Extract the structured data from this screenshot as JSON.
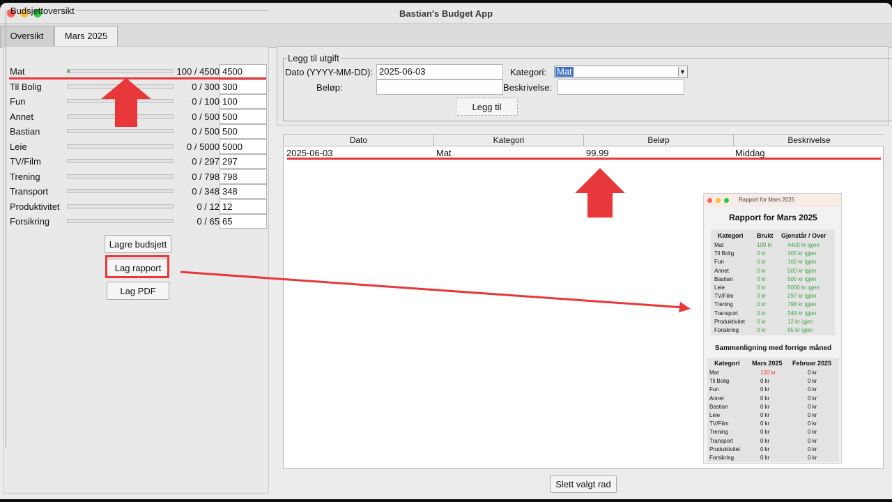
{
  "window": {
    "title": "Bastian's Budget App"
  },
  "tabs": [
    {
      "label": "Oversikt"
    },
    {
      "label": "Mars 2025"
    }
  ],
  "budget": {
    "group_label": "Budsjettoversikt",
    "rows": [
      {
        "name": "Mat",
        "status": "100 / 4500",
        "input": "4500",
        "fill": 0.022
      },
      {
        "name": "Til Bolig",
        "status": "0 / 300",
        "input": "300",
        "fill": 0
      },
      {
        "name": "Fun",
        "status": "0 / 100",
        "input": "100",
        "fill": 0
      },
      {
        "name": "Annet",
        "status": "0 / 500",
        "input": "500",
        "fill": 0
      },
      {
        "name": "Bastian",
        "status": "0 / 500",
        "input": "500",
        "fill": 0
      },
      {
        "name": "Leie",
        "status": "0 / 5000",
        "input": "5000",
        "fill": 0
      },
      {
        "name": "TV/Film",
        "status": "0 / 297",
        "input": "297",
        "fill": 0
      },
      {
        "name": "Trening",
        "status": "0 / 798",
        "input": "798",
        "fill": 0
      },
      {
        "name": "Transport",
        "status": "0 / 348",
        "input": "348",
        "fill": 0
      },
      {
        "name": "Produktivitet",
        "status": "0 / 12",
        "input": "12",
        "fill": 0
      },
      {
        "name": "Forsikring",
        "status": "0 / 65",
        "input": "65",
        "fill": 0
      }
    ],
    "buttons": {
      "save": "Lagre budsjett",
      "report": "Lag rapport",
      "pdf": "Lag PDF"
    }
  },
  "add_expense": {
    "group_label": "Legg til utgift",
    "date_label": "Dato (YYYY-MM-DD):",
    "date_value": "2025-06-03",
    "category_label": "Kategori:",
    "category_value": "Mat",
    "amount_label": "Beløp:",
    "amount_value": "",
    "desc_label": "Beskrivelse:",
    "desc_value": "",
    "add_button": "Legg til"
  },
  "expenses_table": {
    "headers": [
      "Dato",
      "Kategori",
      "Beløp",
      "Beskrivelse"
    ],
    "rows": [
      {
        "dato": "2025-06-03",
        "kategori": "Mat",
        "belop": "99.99",
        "beskrivelse": "Middag"
      }
    ]
  },
  "delete_button": "Slett valgt rad",
  "report": {
    "window_title": "Rapport for Mars 2025",
    "title": "Rapport for Mars 2025",
    "headers": [
      "Kategori",
      "Brukt",
      "Gjenstår / Over"
    ],
    "rows": [
      [
        "Mat",
        "100 kr",
        "4400 kr igjen"
      ],
      [
        "Til Bolig",
        "0 kr",
        "300 kr igjen"
      ],
      [
        "Fun",
        "0 kr",
        "100 kr igjen"
      ],
      [
        "Annet",
        "0 kr",
        "500 kr igjen"
      ],
      [
        "Bastian",
        "0 kr",
        "500 kr igjen"
      ],
      [
        "Leie",
        "0 kr",
        "5000 kr igjen"
      ],
      [
        "TV/Film",
        "0 kr",
        "297 kr igjen"
      ],
      [
        "Trening",
        "0 kr",
        "798 kr igjen"
      ],
      [
        "Transport",
        "0 kr",
        "348 kr igjen"
      ],
      [
        "Produktivitet",
        "0 kr",
        "12 kr igjen"
      ],
      [
        "Forsikring",
        "0 kr",
        "65 kr igjen"
      ]
    ],
    "compare_title": "Sammenligning med forrige måned",
    "compare_headers": [
      "Kategori",
      "Mars 2025",
      "Februar 2025"
    ],
    "compare_rows": [
      [
        "Mat",
        "100 kr",
        "0 kr"
      ],
      [
        "Til Bolig",
        "0 kr",
        "0 kr"
      ],
      [
        "Fun",
        "0 kr",
        "0 kr"
      ],
      [
        "Annet",
        "0 kr",
        "0 kr"
      ],
      [
        "Bastian",
        "0 kr",
        "0 kr"
      ],
      [
        "Leie",
        "0 kr",
        "0 kr"
      ],
      [
        "TV/Film",
        "0 kr",
        "0 kr"
      ],
      [
        "Trening",
        "0 kr",
        "0 kr"
      ],
      [
        "Transport",
        "0 kr",
        "0 kr"
      ],
      [
        "Produktivitet",
        "0 kr",
        "0 kr"
      ],
      [
        "Forsikring",
        "0 kr",
        "0 kr"
      ]
    ]
  },
  "colors": {
    "accent_red": "#e8373a",
    "progress_green": "#4caf50",
    "select_blue": "#3f74c4"
  }
}
